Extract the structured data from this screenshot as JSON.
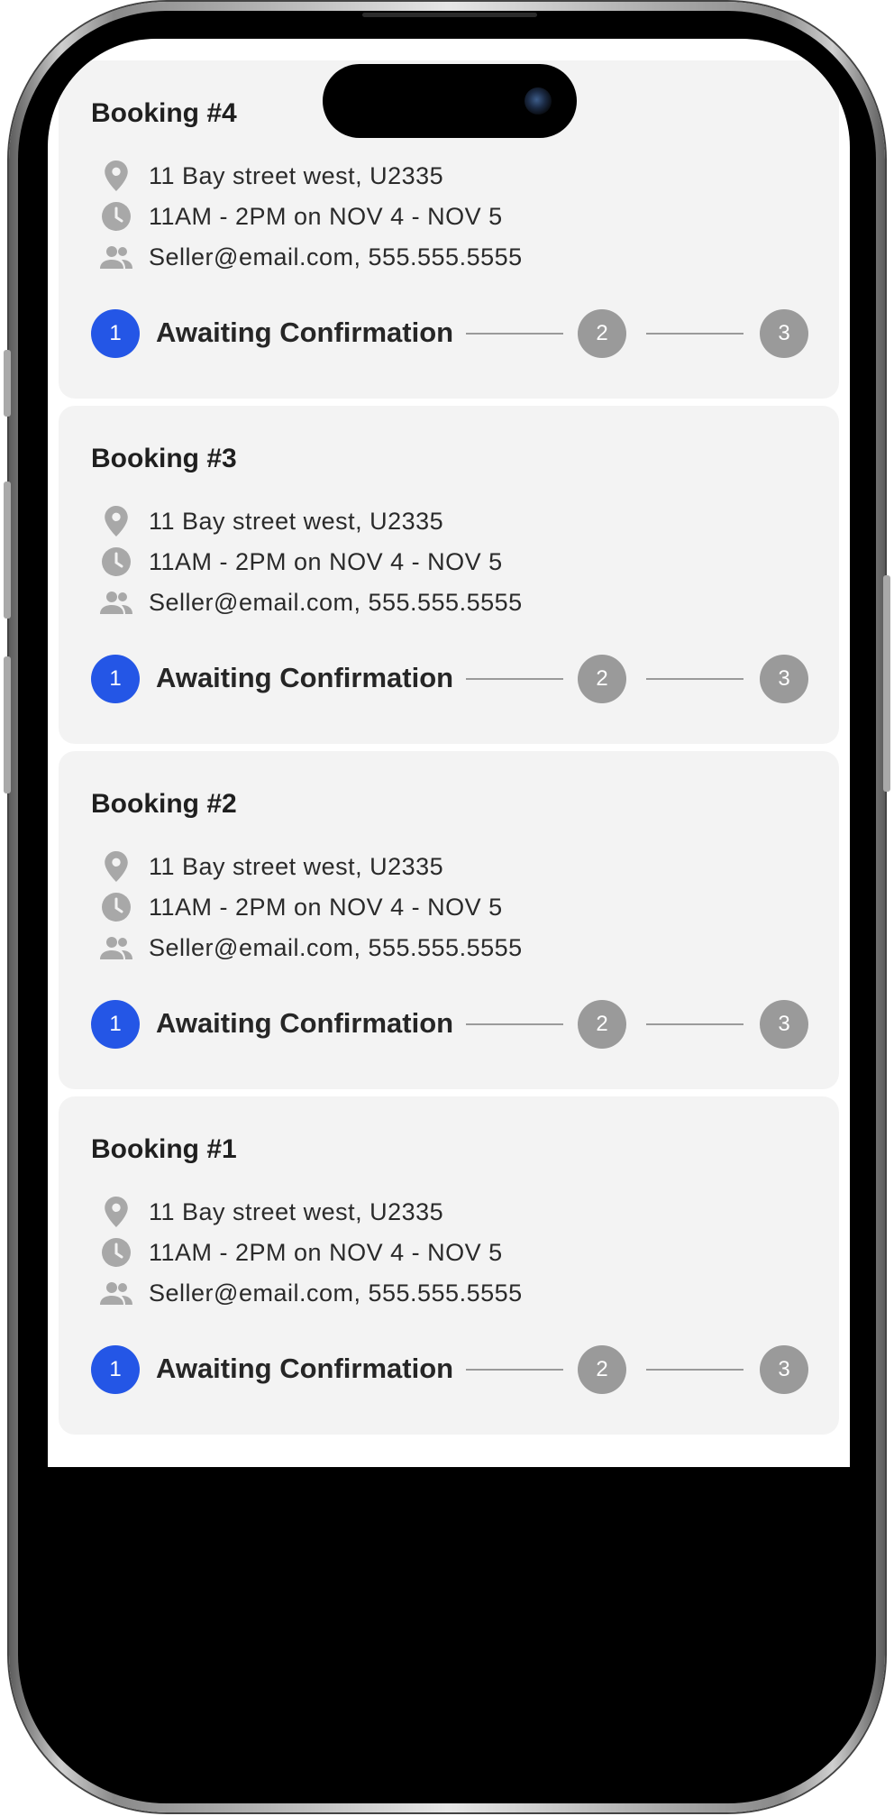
{
  "bookings": [
    {
      "title": "Booking #4",
      "address": "11 Bay street west, U2335",
      "time": "11AM - 2PM on NOV 4 - NOV 5",
      "contact": "Seller@email.com, 555.555.5555",
      "status_label": "Awaiting Confirmation",
      "steps": [
        "1",
        "2",
        "3"
      ]
    },
    {
      "title": "Booking #3",
      "address": "11 Bay street west, U2335",
      "time": "11AM - 2PM on NOV 4 - NOV 5",
      "contact": "Seller@email.com, 555.555.5555",
      "status_label": "Awaiting Confirmation",
      "steps": [
        "1",
        "2",
        "3"
      ]
    },
    {
      "title": "Booking #2",
      "address": "11 Bay street west, U2335",
      "time": "11AM - 2PM on NOV 4 - NOV 5",
      "contact": "Seller@email.com, 555.555.5555",
      "status_label": "Awaiting Confirmation",
      "steps": [
        "1",
        "2",
        "3"
      ]
    },
    {
      "title": "Booking #1",
      "address": "11 Bay street west, U2335",
      "time": "11AM - 2PM on NOV 4 - NOV 5",
      "contact": "Seller@email.com, 555.555.5555",
      "status_label": "Awaiting Confirmation",
      "steps": [
        "1",
        "2",
        "3"
      ]
    }
  ],
  "icons": {
    "address": "location-pin-icon",
    "time": "clock-icon",
    "contact": "people-icon"
  },
  "colors": {
    "active_step": "#2456e6",
    "inactive_step": "#9a9a9a",
    "card_background": "#f3f3f3"
  }
}
